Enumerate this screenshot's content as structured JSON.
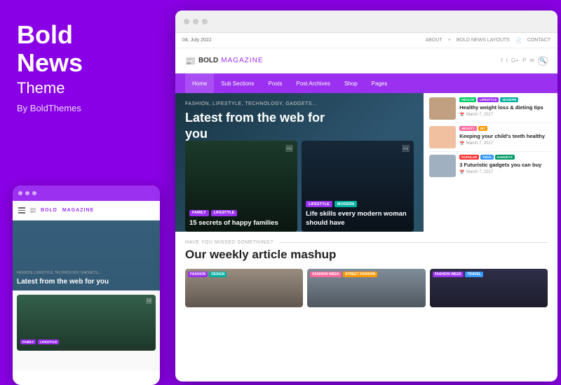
{
  "left": {
    "brand_bold": "Bold",
    "brand_news": "News",
    "brand_theme": "Theme",
    "brand_by": "By BoldThemes",
    "mobile_dots": [
      "dot1",
      "dot2",
      "dot3"
    ],
    "mobile_logo": "BOLD MAGAZINE",
    "mobile_tag": "FASHION, LIFESTYLE, TECHNOLOGY, GADGETS...",
    "mobile_hero_title": "Latest from the web for you",
    "mobile_tag_family": "FAMILY",
    "mobile_tag_lifestyle": "LIFESTYLE"
  },
  "browser": {
    "topbar": {
      "date": "04, July 2022",
      "links": [
        "ABOUT",
        "BOLD NEWS LAYOUTS",
        "CONTACT"
      ]
    },
    "logo": {
      "bold": "BOLD",
      "magazine": "MAGAZINE"
    },
    "nav": {
      "items": [
        "Home",
        "Sub Sections",
        "Posts",
        "Post Archives",
        "Shop",
        "Pages"
      ]
    },
    "hero": {
      "tag": "FASHION, LIFESTYLE, TECHNOLOGY, GADGETS...",
      "title": "Latest from the web for you",
      "card1": {
        "tags": [
          "FAMILY",
          "LIFESTYLE"
        ],
        "title": "15 secrets of happy families"
      },
      "card2": {
        "tags": [
          "LIFESTYLE",
          "MODERN"
        ],
        "title": "Life skills every modern woman should have"
      }
    },
    "right_articles": [
      {
        "tags": [
          "HEALTH",
          "LIFESTYLE",
          "MODERN"
        ],
        "title": "Healthy weight loss & dieting tips",
        "date": "March 7, 2017"
      },
      {
        "tags": [
          "BEAUTY",
          "DIY"
        ],
        "title": "Keeping your child's teeth healthy",
        "date": "March 7, 2017"
      },
      {
        "tags": [
          "POPULAR",
          "TECH",
          "GADGETS"
        ],
        "title": "3 Futuristic gadgets you can buy",
        "date": "March 7, 2017"
      }
    ],
    "bottom": {
      "pre_label": "HAVE YOU MISSED SOMETHING?",
      "section_title": "Our weekly article mashup",
      "cards": [
        {
          "tags": [
            "FASHION",
            "DESIGN"
          ]
        },
        {
          "tags": [
            "FASHION WEEK",
            "STREET FASHION"
          ]
        },
        {
          "tags": [
            "FASHION WEEK",
            "TRAVEL"
          ]
        }
      ]
    }
  }
}
